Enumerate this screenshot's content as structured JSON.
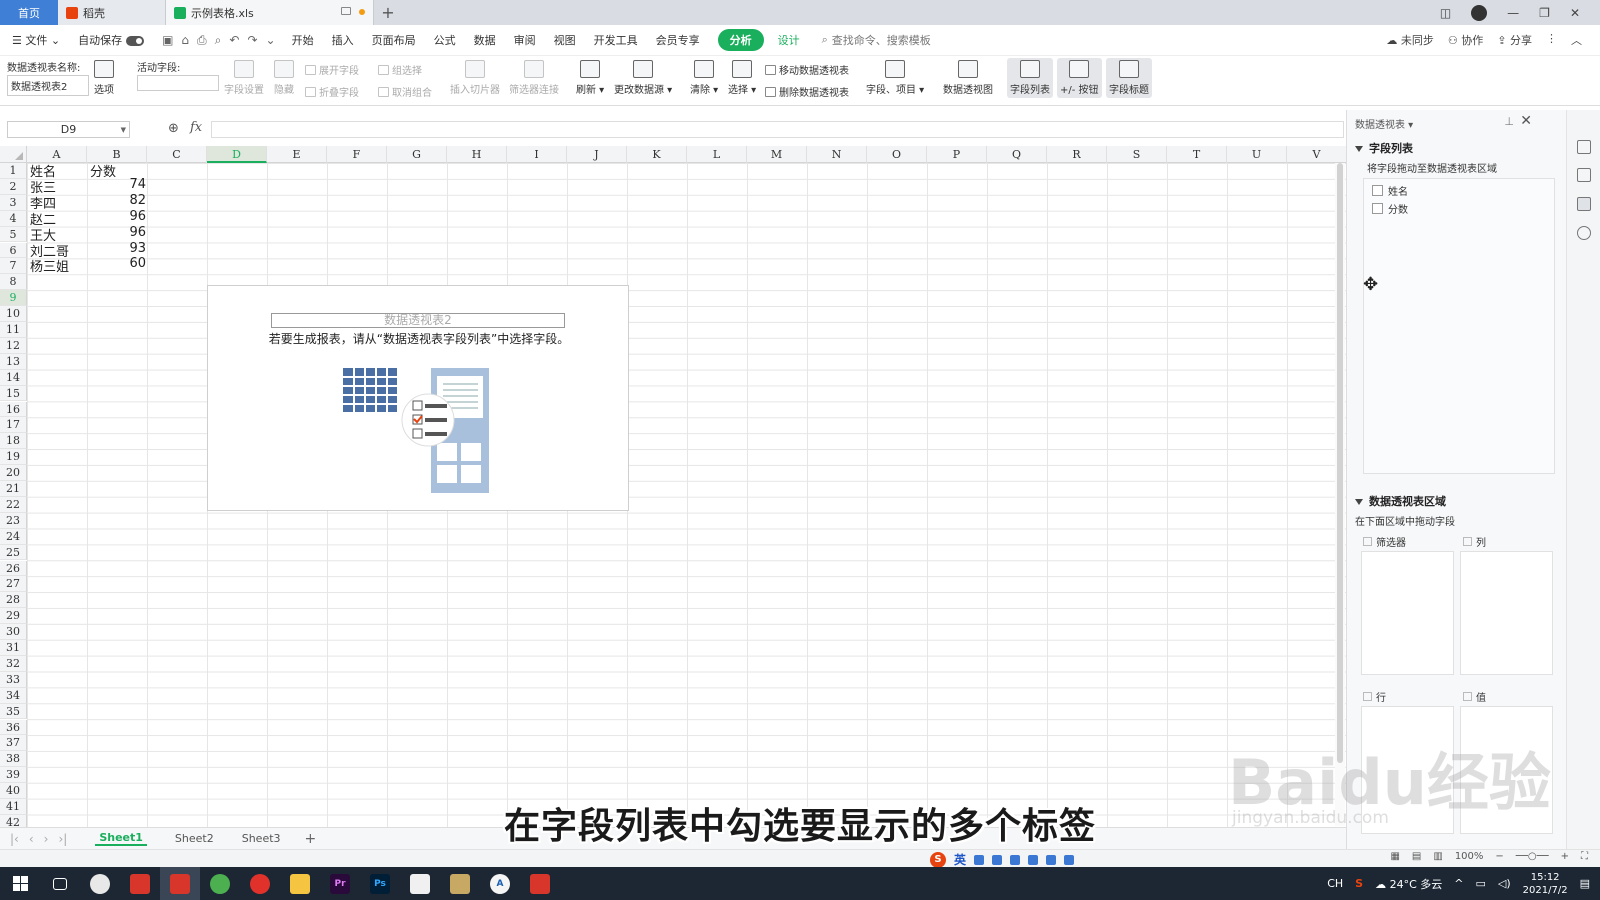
{
  "titlebar": {
    "home": "首页",
    "tabs": [
      {
        "label": "稻壳"
      },
      {
        "label": "示例表格.xls"
      }
    ],
    "new_tab": "+"
  },
  "menubar": {
    "file": "文件",
    "autosave": "自动保存",
    "menus": [
      "开始",
      "插入",
      "页面布局",
      "公式",
      "数据",
      "审阅",
      "视图",
      "开发工具",
      "会员专享"
    ],
    "active_menu": "分析",
    "design": "设计",
    "search": "查找命令、搜索模板",
    "right": [
      "未同步",
      "协作",
      "分享"
    ]
  },
  "ribbon": {
    "pivot_name_label": "数据透视表名称:",
    "pivot_name": "数据透视表2",
    "options": "选项",
    "active_field_label": "活动字段:",
    "field_settings": "字段设置",
    "hide": "隐藏",
    "expand_field": "展开字段",
    "collapse_field": "折叠字段",
    "group_selection": "组选择",
    "ungroup": "取消组合",
    "insert_slicer": "插入切片器",
    "filter_conn": "筛选器连接",
    "refresh": "刷新",
    "change_source": "更改数据源",
    "clear": "清除",
    "select": "选择",
    "move_pivot": "移动数据透视表",
    "delete_pivot": "删除数据透视表",
    "fields_items": "字段、项目",
    "pivot_chart": "数据透视图",
    "field_list": "字段列表",
    "plusminus": "+/- 按钮",
    "field_headers": "字段标题"
  },
  "formula": {
    "cell_ref": "D9",
    "fx": "fx",
    "value": ""
  },
  "grid": {
    "columns": [
      "A",
      "B",
      "C",
      "D",
      "E",
      "F",
      "G",
      "H",
      "I",
      "J",
      "K",
      "L",
      "M",
      "N",
      "O",
      "P",
      "Q",
      "R",
      "S",
      "T",
      "U",
      "V"
    ],
    "rows": [
      "1",
      "2",
      "3",
      "4",
      "5",
      "6",
      "7",
      "8",
      "9",
      "10",
      "11",
      "12",
      "13",
      "14",
      "15",
      "16",
      "17",
      "18",
      "19",
      "20",
      "21",
      "22",
      "23",
      "24",
      "25",
      "26",
      "27",
      "28",
      "29",
      "30",
      "31",
      "32",
      "33",
      "34",
      "35",
      "36",
      "37",
      "38",
      "39",
      "40",
      "41",
      "42"
    ],
    "selected_col": "D",
    "selected_row": "9",
    "data": {
      "a1": "姓名",
      "b1": "分数",
      "names": [
        "张三",
        "李四",
        "赵二",
        "王大",
        "刘二哥",
        "杨三姐"
      ],
      "scores": [
        "74",
        "82",
        "96",
        "96",
        "93",
        "60"
      ]
    }
  },
  "pivot": {
    "title": "数据透视表2",
    "instruction": "若要生成报表，请从“数据透视表字段列表”中选择字段。"
  },
  "sheets": {
    "tabs": [
      "Sheet1",
      "Sheet2",
      "Sheet3"
    ],
    "active": "Sheet1",
    "add": "+"
  },
  "panel": {
    "header": "数据透视表",
    "field_list_title": "字段列表",
    "drag_hint": "将字段拖动至数据透视表区域",
    "fields": [
      "姓名",
      "分数"
    ],
    "areas_title": "数据透视表区域",
    "areas_hint": "在下面区域中拖动字段",
    "filter": "筛选器",
    "columns": "列",
    "rows": "行",
    "values": "值"
  },
  "statusbar": {
    "ime_lang": "英",
    "zoom": "100%"
  },
  "subtitle": "在字段列表中勾选要显示的多个标签",
  "watermark": {
    "main": "Baidu经验",
    "sub": "jingyan.baidu.com"
  },
  "taskbar": {
    "weather": "24°C 多云",
    "time": "15:12",
    "date": "2021/7/2",
    "lang": "CH"
  },
  "colors": {
    "accent": "#1aaf5d",
    "home_tab": "#3f7fd6",
    "taskbar": "#1c2733"
  }
}
